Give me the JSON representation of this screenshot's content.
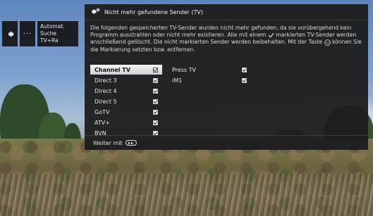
{
  "side_tiles": {
    "more_label": "···",
    "search_line1": "Automat.",
    "search_line2": "Suche TV+Ra"
  },
  "dialog": {
    "title": "Nicht mehr gefundene Sender (TV)",
    "message_part1": "Die folgenden gespeicherten TV-Sender wurden nicht mehr gefunden, da sie vorübergehend kein Programm ausstrahlen oder nicht mehr existieren. Alle mit einem",
    "message_part2": "markierten TV-Sender werden anschließend gelöscht. Die nicht markierten Sender werden beibehalten. Mit der Taste",
    "message_part3": "können Sie die Markierung setzten bzw. entfernen.",
    "ok_key_label": "OK",
    "footer_label": "Weiter mit"
  },
  "channels_left": [
    {
      "name": "Channel TV",
      "checked": true,
      "selected": true
    },
    {
      "name": "Direct 3",
      "checked": true
    },
    {
      "name": "Direct 4",
      "checked": true
    },
    {
      "name": "Direct 5",
      "checked": true
    },
    {
      "name": "GoTV",
      "checked": true
    },
    {
      "name": "ATV+",
      "checked": true
    },
    {
      "name": "BVN",
      "checked": true
    }
  ],
  "channels_right": [
    {
      "name": "Press TV",
      "checked": true
    },
    {
      "name": "iM1",
      "checked": true
    }
  ],
  "colors": {
    "dialog_bg": "#1c1c1e",
    "selection_bg": "#e6e6e6",
    "text": "#e6e6e6"
  }
}
